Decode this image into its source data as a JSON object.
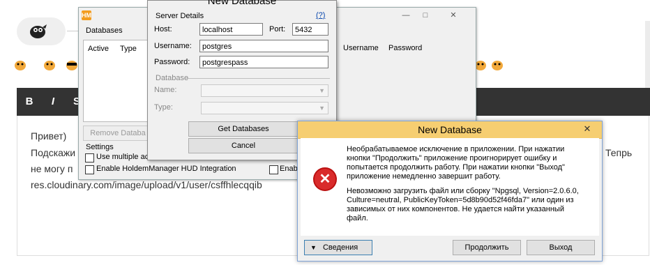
{
  "forum": {
    "toolbar": {
      "bold": "B",
      "italic": "I",
      "more": "S"
    },
    "post": {
      "line1": "Привет)",
      "line2": "Подскажи",
      "line2_tail": "Тепрь",
      "line3": "не могу п",
      "line4": "res.cloudinary.com/image/upload/v1/user/csffhlecqqib"
    }
  },
  "hm_window": {
    "logo": "HM",
    "databases_group": "Databases",
    "columns": [
      "Active",
      "Type",
      "Username",
      "Password"
    ],
    "remove_button": "Remove Databa",
    "settings_group": "Settings",
    "option_multiple": "Use multiple act",
    "option_hud": "Enable  HoldemManager  HUD  Integration",
    "option_enab": "Enab"
  },
  "server_dialog": {
    "title": "New Database",
    "server_group": "Server Details",
    "help": "(?)",
    "host_label": "Host:",
    "host_value": "localhost",
    "port_label": "Port:",
    "port_value": "5432",
    "username_label": "Username:",
    "username_value": "postgres",
    "password_label": "Password:",
    "password_value": "postgrespass",
    "database_group": "Database",
    "name_label": "Name:",
    "type_label": "Type:",
    "get_button": "Get Databases",
    "cancel_button": "Cancel"
  },
  "error_dialog": {
    "title": "New Database",
    "close": "✕",
    "para1": [
      "Необрабатываемое исключение в приложении. При нажатии",
      "кнопки \"Продолжить\" приложение проигнорирует ошибку и",
      "попытается продолжить работу. При нажатии кнопки \"Выход\"",
      "приложение немедленно завершит работу."
    ],
    "para2": [
      "Невозможно загрузить файл или сборку \"Npgsql, Version=2.0.6.0,",
      "Culture=neutral, PublicKeyToken=5d8b90d52f46fda7\" или один из",
      "зависимых от них компонентов. Не удается найти указанный",
      "файл."
    ],
    "details_button": "Сведения",
    "continue_button": "Продолжить",
    "exit_button": "Выход",
    "icon": "error-icon"
  }
}
